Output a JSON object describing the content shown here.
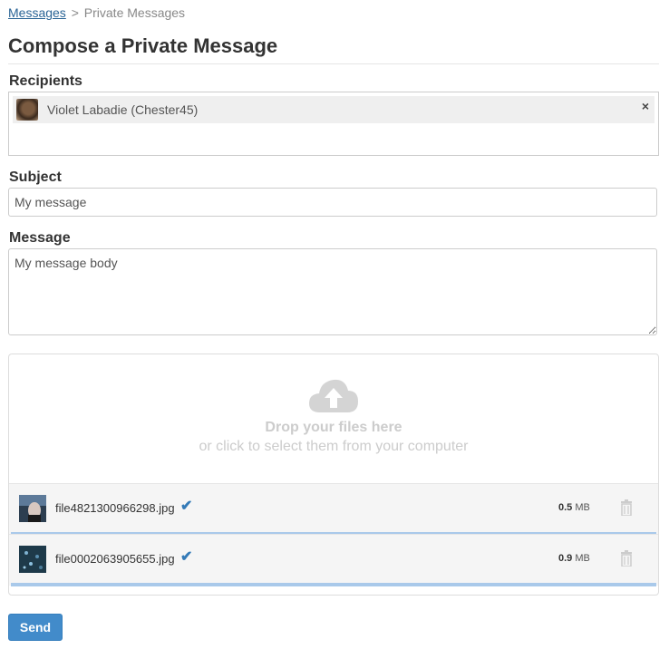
{
  "breadcrumb": {
    "link": "Messages",
    "separator": ">",
    "current": "Private Messages"
  },
  "page_title": "Compose a Private Message",
  "recipients": {
    "label": "Recipients",
    "tokens": [
      {
        "name": "Violet Labadie (Chester45)",
        "remove_glyph": "×"
      }
    ]
  },
  "subject": {
    "label": "Subject",
    "value": "My message"
  },
  "message": {
    "label": "Message",
    "value": "My message body"
  },
  "dropzone": {
    "icon": "cloud-upload-icon",
    "title": "Drop your files here",
    "subtitle": "or click to select them from your computer",
    "files": [
      {
        "name": "file4821300966298.jpg",
        "size": "0.5",
        "unit": "MB",
        "status_icon": "check-icon",
        "upload_progress": 1.0
      },
      {
        "name": "file0002063905655.jpg",
        "size": "0.9",
        "unit": "MB",
        "status_icon": "check-icon",
        "upload_progress": 1.0
      }
    ]
  },
  "send_label": "Send",
  "colors": {
    "accent": "#428bca",
    "link": "#2a6496",
    "progress": "#a9c9ea",
    "check": "#337ab7"
  }
}
